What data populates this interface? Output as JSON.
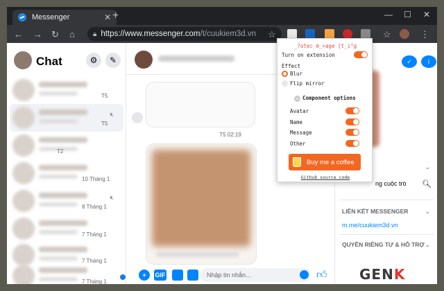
{
  "browser": {
    "tab_title": "Messenger",
    "tab_close": "✕",
    "new_tab": "+",
    "url_host": "https://www.messenger.com",
    "url_path": "/t/cuukiem3d.vn",
    "window_controls": [
      "—",
      "☐",
      "✕"
    ]
  },
  "left": {
    "title": "Chat",
    "conversations": [
      {
        "time": "T5",
        "muted": false,
        "active": false
      },
      {
        "time": "T5",
        "muted": true,
        "active": true
      },
      {
        "time": "T2",
        "muted": false,
        "active": false
      },
      {
        "time": "10 Tháng 1",
        "muted": false,
        "active": false
      },
      {
        "time": "8 Tháng 1",
        "muted": true,
        "active": false
      },
      {
        "time": "7 Tháng 1",
        "muted": false,
        "active": false
      },
      {
        "time": "7 Tháng 1",
        "muted": false,
        "active": false
      },
      {
        "time": "7 Tháng 1",
        "muted": false,
        "active": false
      }
    ]
  },
  "center": {
    "timestamp": "T5 02:19",
    "composer_placeholder": "Nhập tin nhắn...",
    "gif_label": "GIF"
  },
  "right": {
    "search_row": "ng cuộc trò",
    "section_links": "LIÊN KẾT MESSENGER",
    "link": "m.me/cuukiem3d.vn",
    "section_privacy": "QUYỀN RIÊNG TƯ & HỖ TRỢ"
  },
  "popup": {
    "title": "_?otec m_+age [t_i^g",
    "turn_on": "Turn on extension",
    "effect": "Effect",
    "blur": "Blur",
    "flip": "Flip mirror",
    "component_options": "Component options",
    "options": [
      "Avatar",
      "Name",
      "Message",
      "Other"
    ],
    "coffee": "Buy me a coffee",
    "github": "Github source code"
  },
  "watermark": {
    "a": "GEN",
    "b": "K"
  },
  "colors": {
    "accent": "#f26722",
    "messenger_blue": "#0084ff"
  }
}
